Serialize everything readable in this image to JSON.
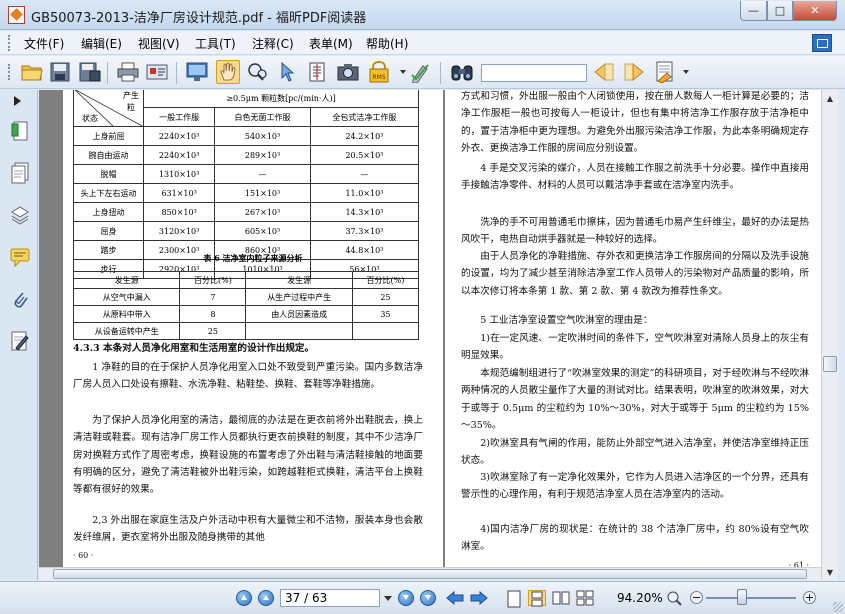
{
  "window": {
    "title": "GB50073-2013-洁净厂房设计规范.pdf - 福昕PDF阅读器",
    "minimize": "—",
    "maximize": "□",
    "close": "✕"
  },
  "menu": [
    "文件(F)",
    "编辑(E)",
    "视图(V)",
    "工具(T)",
    "注释(C)",
    "表单(M)",
    "帮助(H)"
  ],
  "toolbar": {
    "icons": [
      "open-folder-icon",
      "save-icon",
      "save-as-icon",
      "print-icon",
      "scan-icon",
      "monitor-icon",
      "hand-tool-icon",
      "zoom-tool-icon",
      "select-cursor-icon",
      "text-select-icon",
      "snapshot-icon",
      "rms-icon",
      "sign-icon",
      "binoculars-icon",
      "prev-find-icon",
      "next-find-icon",
      "highlight-icon"
    ],
    "rms_label": "RMS",
    "search_value": ""
  },
  "left_panel": {
    "icons": [
      "expand-arrow-icon",
      "bookmarks-icon",
      "pages-icon",
      "layers-icon",
      "comments-icon",
      "attachments-icon",
      "signature-icon"
    ]
  },
  "page_left": {
    "table5": {
      "corner_top": "产生",
      "corner_row": "粒",
      "corner_state": "状态",
      "header_span": "≥0.5μm 颗粒数[pc/(min·人)]",
      "cols": [
        "一般工作服",
        "白色无菌工作服",
        "全包式洁净工作服"
      ],
      "rows": [
        [
          "上身前屈",
          "2240×10³",
          "540×10³",
          "24.2×10³"
        ],
        [
          "腕自由运动",
          "2240×10³",
          "289×10³",
          "20.5×10³"
        ],
        [
          "脱帽",
          "1310×10³",
          "—",
          "—"
        ],
        [
          "头上下左右运动",
          "631×10³",
          "151×10³",
          "11.0×10³"
        ],
        [
          "上身扭动",
          "850×10³",
          "267×10³",
          "14.3×10³"
        ],
        [
          "屈身",
          "3120×10³",
          "605×10³",
          "37.3×10³"
        ],
        [
          "踏步",
          "2300×10³",
          "860×10³",
          "44.8×10³"
        ],
        [
          "步行",
          "2920×10³",
          "1010×10³",
          "56×10³"
        ]
      ]
    },
    "table6_caption": "表 6   洁净室内粒子来源分析",
    "table6": {
      "cols": [
        "发生源",
        "百分比(%)",
        "发生源",
        "百分比(%)"
      ],
      "rows": [
        [
          "从空气中漏入",
          "7",
          "从生产过程中产生",
          "25"
        ],
        [
          "从原料中带入",
          "8",
          "由人员因素造成",
          "35"
        ],
        [
          "从设备运转中产生",
          "25",
          "",
          ""
        ]
      ]
    },
    "paragraphs": [
      "4.3.3   本条对人员净化用室和生活用室的设计作出规定。",
      "1   净鞋的目的在于保护人员净化用室入口处不致受到严重污染。国内多数洁净厂房人员入口处设有擦鞋、水洗净鞋、粘鞋垫、换鞋、套鞋等净鞋措施。",
      "为了保护人员净化用室的清洁，最彻底的办法是在更衣前将外出鞋脱去，换上清洁鞋或鞋套。现有洁净厂房工作人员都执行更衣前换鞋的制度，其中不少洁净厂房对换鞋方式作了周密考虑，换鞋设施的布置考虑了外出鞋与清洁鞋接触的地面要有明确的区分，避免了清洁鞋被外出鞋污染，如跨越鞋柜式换鞋，清洁平台上换鞋等都有很好的效果。",
      "2,3   外出服在家庭生活及户外活动中积有大量微尘和不洁物，服装本身也会散发纤维屑，更衣室将外出服及随身携带的其他"
    ],
    "page_number": "· 60 ·"
  },
  "page_right": {
    "paragraphs": [
      "方式和习惯，外出服一般由个人闭锁使用，按在册人数每人一柜计算是必要的；洁净工作服柜一般也可按每人一柜设计，但也有集中将洁净工作服存放于洁净柜中的，置于洁净柜中更为理想。为避免外出服污染洁净工作服，为此本条明确规定存外衣、更换洁净工作服的房间应分别设置。",
      "4   手是交叉污染的媒介，人员在接触工作服之前洗手十分必要。操作中直接用手接触洁净零件、材料的人员可以戴洁净手套或在洁净室内洗手。",
      "洗净的手不可用普通毛巾擦抹，因为普通毛巾易产生纤维尘，最好的办法是热风吹干，电热自动烘手器就是一种较好的选择。",
      "由于人员净化的净鞋措施、存外衣和更换洁净工作服房间的分隔以及洗手设施的设置，均为了减少甚至消除洁净室工作人员带人的污染物对产品质量的影响，所以本次修订将本条第 1 款、第 2 款、第 4 款改为推荐性条文。",
      "5   工业洁净室设置空气吹淋室的理由是：",
      "1)在一定风速、一定吹淋时间的条件下，空气吹淋室对清除人员身上的灰尘有明显效果。",
      "本规范编制组进行了“吹淋室效果的测定”的科研项目，对于经吹淋与不经吹淋两种情况的人员散尘量作了大量的测试对比。结果表明，吹淋室的吹淋效果，对大于或等于 0.5μm 的尘粒约为 10%～30%，对大于或等于 5μm 的尘粒约为 15%～35%。",
      "2)吹淋室具有气闸的作用，能防止外部空气进入洁净室，并使洁净室维持正压状态。",
      "3)吹淋室除了有一定净化效果外，它作为人员进入洁净区的一个分界，还具有警示性的心理作用，有利于规范洁净室人员在洁净室内的活动。",
      "4)国内洁净厂房的现状是：在统计的 38 个洁净厂房中，约 80%设有空气吹淋室。"
    ],
    "page_number": "· 61 ·"
  },
  "status": {
    "page_input": "37 / 63",
    "zoom": "94.20%",
    "zoom_level": 0.4
  }
}
